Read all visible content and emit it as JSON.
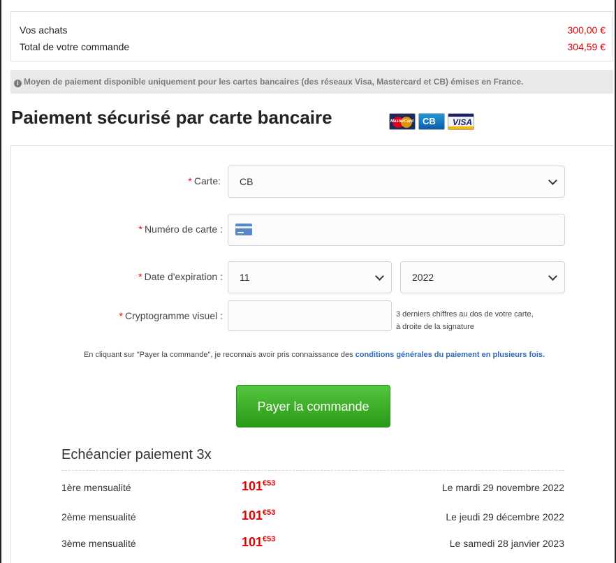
{
  "summary": {
    "purchases_label": "Vos achats",
    "purchases_amount": "300,00 €",
    "total_label": "Total de votre commande",
    "total_amount": "304,59 €"
  },
  "notice": {
    "icon": "info-icon",
    "text": "Moyen de paiement disponible uniquement pour les cartes bancaires (des réseaux Visa, Mastercard et CB) émises en France."
  },
  "title": "Paiement sécurisé par carte bancaire",
  "card_logos": [
    "mastercard",
    "cb",
    "visa"
  ],
  "form": {
    "required_mark": "*",
    "card_label": "Carte:",
    "card_value": "CB",
    "number_label": "Numéro de carte :",
    "number_value": "",
    "expiry_label": "Date d'expiration :",
    "expiry_month": "11",
    "expiry_year": "2022",
    "cvv_label": "Cryptogramme visuel :",
    "cvv_value": "",
    "cvv_hint_line1": "3 derniers chiffres au dos de votre carte,",
    "cvv_hint_line2": "à droite de la signature"
  },
  "terms": {
    "text": "En cliquant sur \"Payer la commande\", je reconnais avoir pris connaissance des ",
    "link": "conditions générales du paiement en plusieurs fois."
  },
  "pay_button": "Payer la commande",
  "schedule": {
    "title": "Echéancier paiement 3x",
    "rows": [
      {
        "name": "1ère mensualité",
        "amount_int": "101",
        "amount_cents": "€53",
        "date": "Le mardi 29 novembre 2022"
      },
      {
        "name": "2ème mensualité",
        "amount_int": "101",
        "amount_cents": "€53",
        "date": "Le jeudi 29 décembre 2022"
      },
      {
        "name": "3ème mensualité",
        "amount_int": "101",
        "amount_cents": "€53",
        "date": "Le samedi 28 janvier 2023"
      }
    ]
  },
  "colors": {
    "price_red": "#e20000",
    "button_green": "#3aab27",
    "link_blue": "#2c69b6"
  }
}
